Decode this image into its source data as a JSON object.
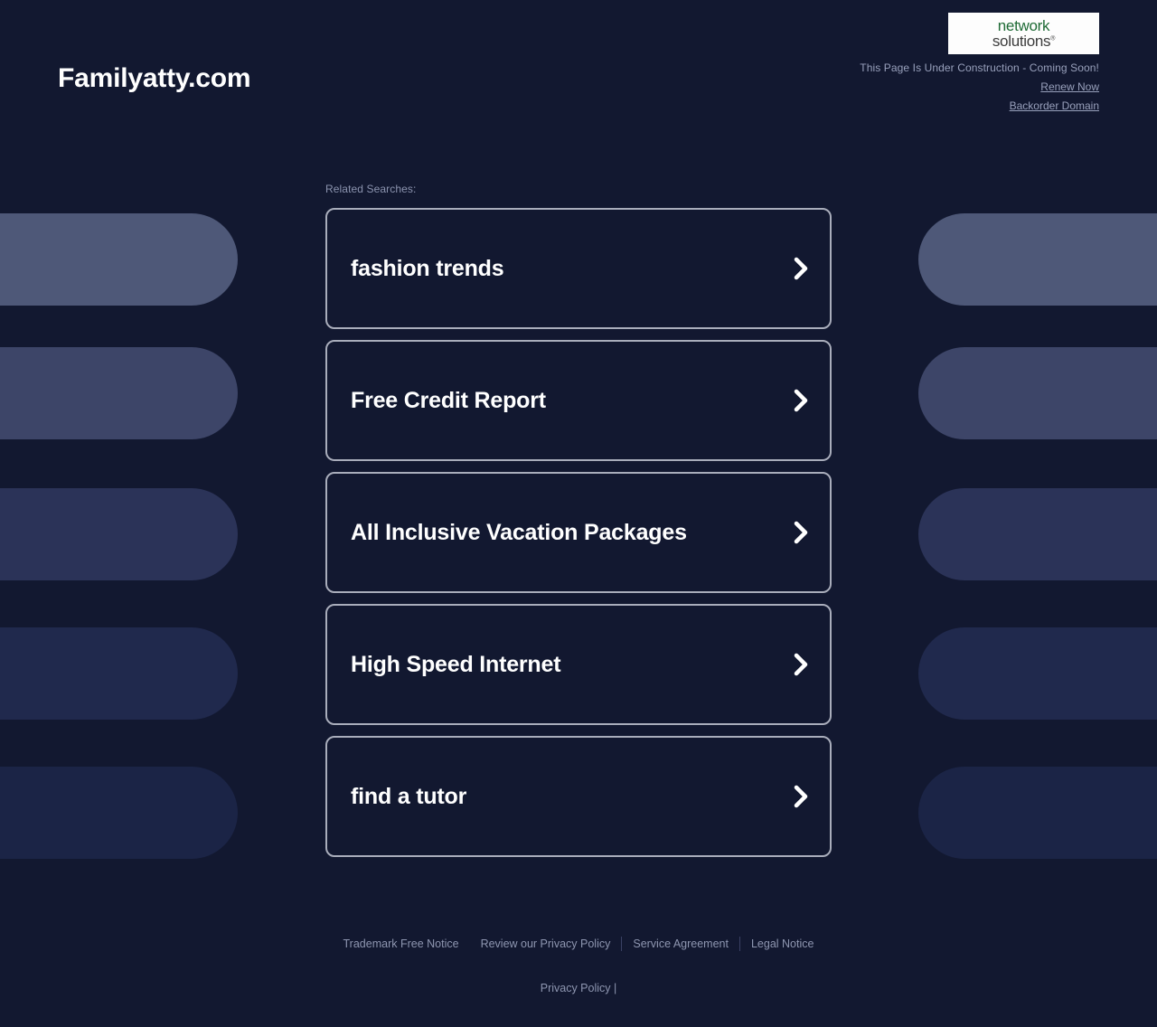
{
  "header": {
    "site_title": "Familyatty.com",
    "logo": {
      "name": "network-solutions-logo",
      "line1": "network",
      "line2": "solutions",
      "registered_mark": "®",
      "green_hex": "#1f6b36",
      "gray_hex": "#3b3b3b"
    },
    "construction_note": "This Page Is Under Construction - Coming Soon!",
    "renew_link": "Renew Now",
    "backorder_link": "Backorder Domain"
  },
  "main": {
    "related_label": "Related Searches:",
    "chevron_icon": "chevron-right-icon",
    "cards": [
      {
        "label": "fashion trends"
      },
      {
        "label": "Free Credit Report"
      },
      {
        "label": "All Inclusive Vacation Packages"
      },
      {
        "label": "High Speed Internet"
      },
      {
        "label": "find a tutor"
      }
    ]
  },
  "footer": {
    "links": [
      {
        "label": "Trademark Free Notice",
        "separator_after": false
      },
      {
        "label": "Review our Privacy Policy",
        "separator_after": true
      },
      {
        "label": "Service Agreement",
        "separator_after": true
      },
      {
        "label": "Legal Notice",
        "separator_after": false
      }
    ],
    "bottom_link": "Privacy Policy",
    "bottom_suffix": "|"
  },
  "theme": {
    "background_hex": "#121830",
    "card_border_hex": "#a9adbb",
    "card_fill_hex": "#121830",
    "text_primary_hex": "#ffffff",
    "text_muted_hex": "#8e96b0"
  },
  "decor": {
    "pill_colors": [
      "#4e5878",
      "#3d4568",
      "#2b3358",
      "#20294d",
      "#1b2446"
    ]
  }
}
